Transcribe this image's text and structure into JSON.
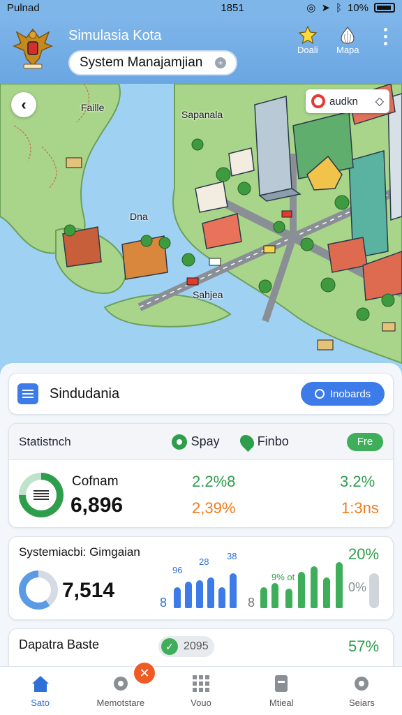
{
  "status_bar": {
    "carrier": "Pulnad",
    "time": "1851",
    "battery": "10%"
  },
  "header": {
    "title": "Simulasia Kota",
    "system_pill": "System Manajamjian",
    "actions": [
      {
        "label": "Doali",
        "icon": "star-icon"
      },
      {
        "label": "Mapa",
        "icon": "garlic-icon"
      }
    ]
  },
  "map": {
    "labels": {
      "faille": "Faille",
      "sapanala": "Sapanala",
      "dna": "Dna",
      "sahjea": "Sahjea"
    },
    "audit_chip": "audkn"
  },
  "search_card": {
    "text": "Sindudania",
    "button": "Inobards"
  },
  "stats_card": {
    "title": "Statistnch",
    "tab1": "Spay",
    "tab2": "Finbo",
    "badge": "Fre",
    "label": "Cofnam",
    "value": "6,896",
    "green_pct": "2.2%8",
    "orange_pct": "2,39%",
    "right_green": "3.2%",
    "right_orange": "1:3ns"
  },
  "system_card": {
    "title": "Systemiacbi: Gimgaian",
    "value": "7,514",
    "pct_top": "20%",
    "pct_mid": "0%",
    "blue_labels": [
      "8",
      "96",
      "28",
      "38"
    ],
    "green_labels": [
      "8",
      "9% ot"
    ]
  },
  "bottom_card": {
    "title": "Dapatra Baste",
    "pill": "2095",
    "pct": "57%"
  },
  "nav": [
    {
      "label": "Sato",
      "icon": "home-icon",
      "active": true
    },
    {
      "label": "Memotstare",
      "icon": "gear-icon"
    },
    {
      "label": "Vouo",
      "icon": "grid-icon"
    },
    {
      "label": "Mtieal",
      "icon": "document-icon"
    },
    {
      "label": "Seiars",
      "icon": "settings-icon"
    }
  ],
  "colors": {
    "accent": "#3d7be8",
    "green": "#2e9d4c",
    "orange": "#f07b1c",
    "header": "#7fb6ea"
  }
}
